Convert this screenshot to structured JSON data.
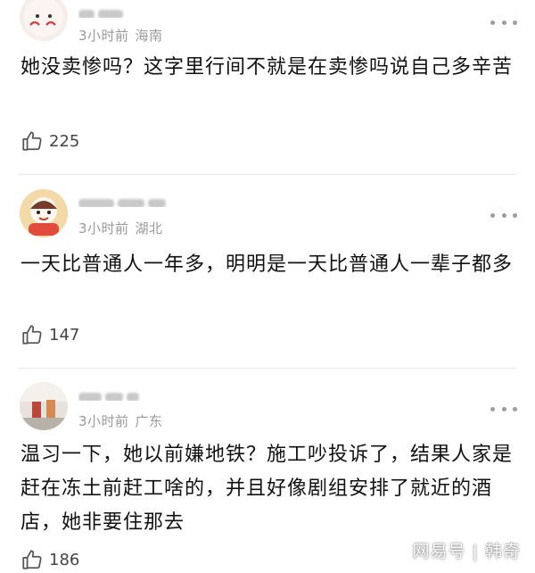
{
  "comments": [
    {
      "time": "3小时前",
      "location": "海南",
      "text": "她没卖惨吗？这字里行间不就是在卖惨吗说自己多辛苦",
      "likes": "225",
      "avatar_icon": "cartoon-face-avatar"
    },
    {
      "time": "3小时前",
      "location": "湖北",
      "text": "一天比普通人一年多，明明是一天比普通人一辈子都多",
      "likes": "147",
      "avatar_icon": "cartoon-character-avatar"
    },
    {
      "time": "3小时前",
      "location": "广东",
      "text": "温习一下，她以前嫌地铁？施工吵投诉了，结果人家是赶在冻土前赶工啥的，并且好像剧组安排了就近的酒店，她非要住那去",
      "likes": "186",
      "avatar_icon": "photo-avatar"
    }
  ],
  "icons": {
    "like": "thumbs-up-icon",
    "more": "more-options-icon"
  },
  "watermark": {
    "text": "网易号 | 韩奇"
  },
  "colors": {
    "meta": "#9a9a9a",
    "text": "#111111",
    "divider": "#e9e9e9"
  }
}
